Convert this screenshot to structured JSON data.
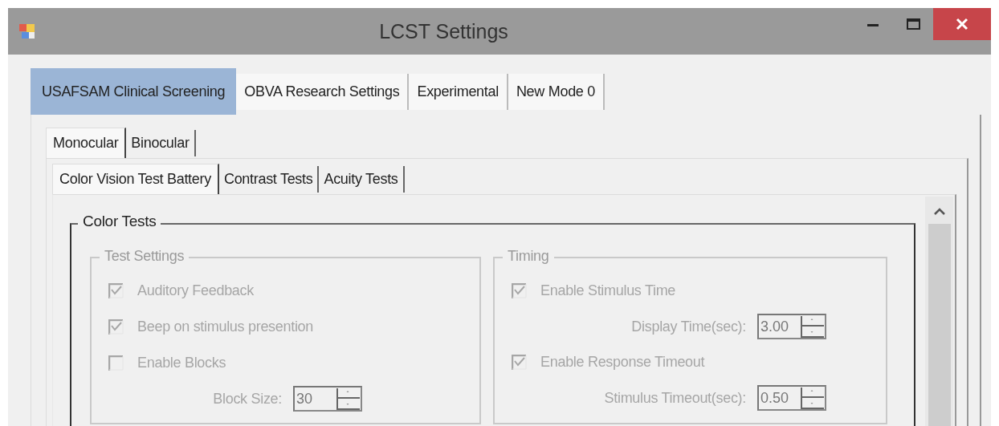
{
  "window": {
    "title": "LCST Settings"
  },
  "tabs": [
    {
      "label": "USAFSAM Clinical Screening",
      "selected": true
    },
    {
      "label": "OBVA Research Settings",
      "selected": false
    },
    {
      "label": "Experimental",
      "selected": false
    },
    {
      "label": "New Mode 0",
      "selected": false
    }
  ],
  "mode_tabs": [
    {
      "label": "Monocular",
      "selected": true
    },
    {
      "label": "Binocular",
      "selected": false
    }
  ],
  "test_tabs": [
    {
      "label": "Color Vision Test Battery",
      "selected": true
    },
    {
      "label": "Contrast Tests",
      "selected": false
    },
    {
      "label": "Acuity Tests",
      "selected": false
    }
  ],
  "color_tests": {
    "title": "Color Tests",
    "groups": [
      {
        "title": "Test Settings",
        "disabled": true,
        "items": [
          {
            "kind": "checkbox",
            "label": "Auditory Feedback",
            "checked": true
          },
          {
            "kind": "checkbox",
            "label": "Beep on stimulus presention",
            "checked": true
          },
          {
            "kind": "checkbox",
            "label": "Enable Blocks",
            "checked": false
          },
          {
            "kind": "spin",
            "label": "Block Size:",
            "value": "30"
          }
        ]
      },
      {
        "title": "Timing",
        "disabled": true,
        "items": [
          {
            "kind": "checkbox",
            "label": "Enable Stimulus Time",
            "checked": true
          },
          {
            "kind": "spin",
            "label": "Display Time(sec):",
            "value": "3.00"
          },
          {
            "kind": "checkbox",
            "label": "Enable Response Timeout",
            "checked": true
          },
          {
            "kind": "spin",
            "label": "Stimulus Timeout(sec):",
            "value": "0.50"
          }
        ]
      }
    ]
  }
}
